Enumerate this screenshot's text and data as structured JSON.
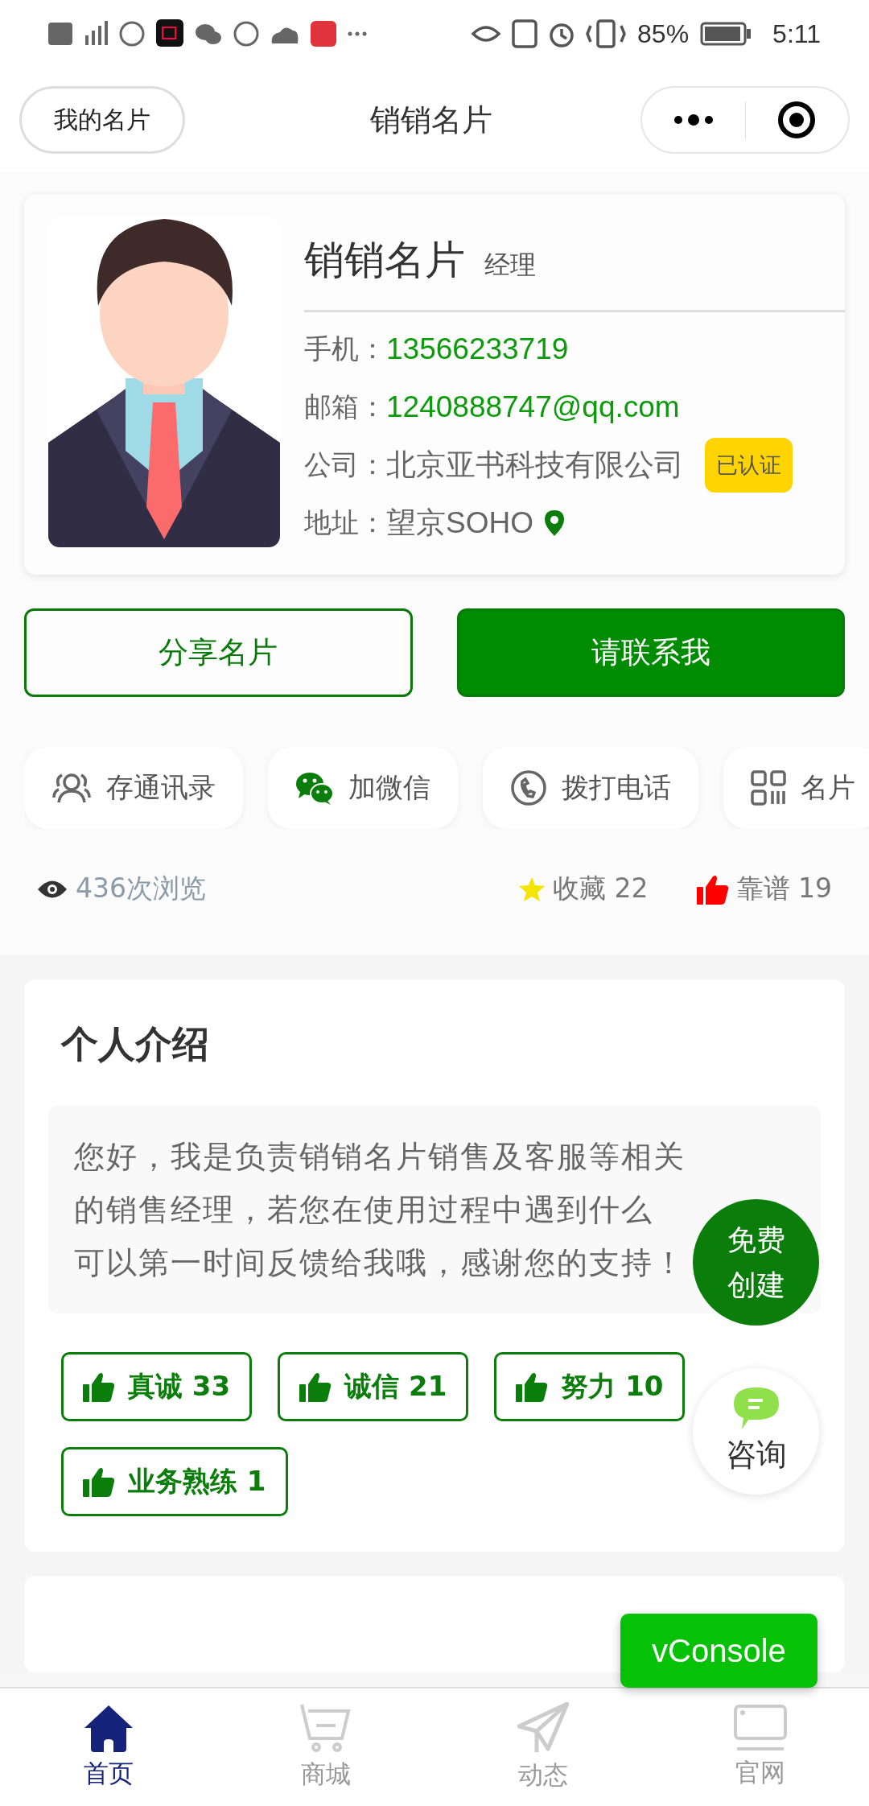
{
  "status_bar": {
    "battery": "85%",
    "time": "5:11"
  },
  "nav": {
    "left_button": "我的名片",
    "title": "销销名片"
  },
  "card": {
    "name": "销销名片",
    "role": "经理",
    "fields": [
      {
        "label": "手机：",
        "value": "13566233719",
        "kind": "contact"
      },
      {
        "label": "邮箱：",
        "value": "1240888747@qq.com",
        "kind": "contact"
      },
      {
        "label": "公司：",
        "value": "北京亚书科技有限公司",
        "kind": "company",
        "badge": "已认证"
      },
      {
        "label": "地址：",
        "value": "望京SOHO",
        "kind": "address"
      }
    ]
  },
  "buttons": [
    {
      "label": "分享名片",
      "kind": "outline"
    },
    {
      "label": "请联系我",
      "kind": "filled"
    }
  ],
  "actions": [
    {
      "label": "存通讯录"
    },
    {
      "label": "加微信"
    },
    {
      "label": "拨打电话"
    },
    {
      "label": "名片"
    }
  ],
  "stats": {
    "views": "436次浏览",
    "favorites": "收藏 22",
    "likes": "靠谱 19"
  },
  "intro": {
    "title": "个人介绍",
    "lines": [
      "您好，我是负责销销名片销售及客服等相关",
      "的销售经理，若您在使用过程中遇到什么",
      "可以第一时间反馈给我哦，感谢您的支持！"
    ],
    "tags": [
      {
        "label": "真诚 33"
      },
      {
        "label": "诚信 21"
      },
      {
        "label": "努力 10"
      },
      {
        "label": "业务熟练 1"
      }
    ]
  },
  "floating": {
    "create": "免费创建",
    "consult": "咨询",
    "console": "vConsole"
  },
  "tabs": [
    {
      "label": "首页",
      "selected": true
    },
    {
      "label": "商城",
      "selected": false
    },
    {
      "label": "动态",
      "selected": false
    },
    {
      "label": "官网",
      "selected": false
    }
  ]
}
